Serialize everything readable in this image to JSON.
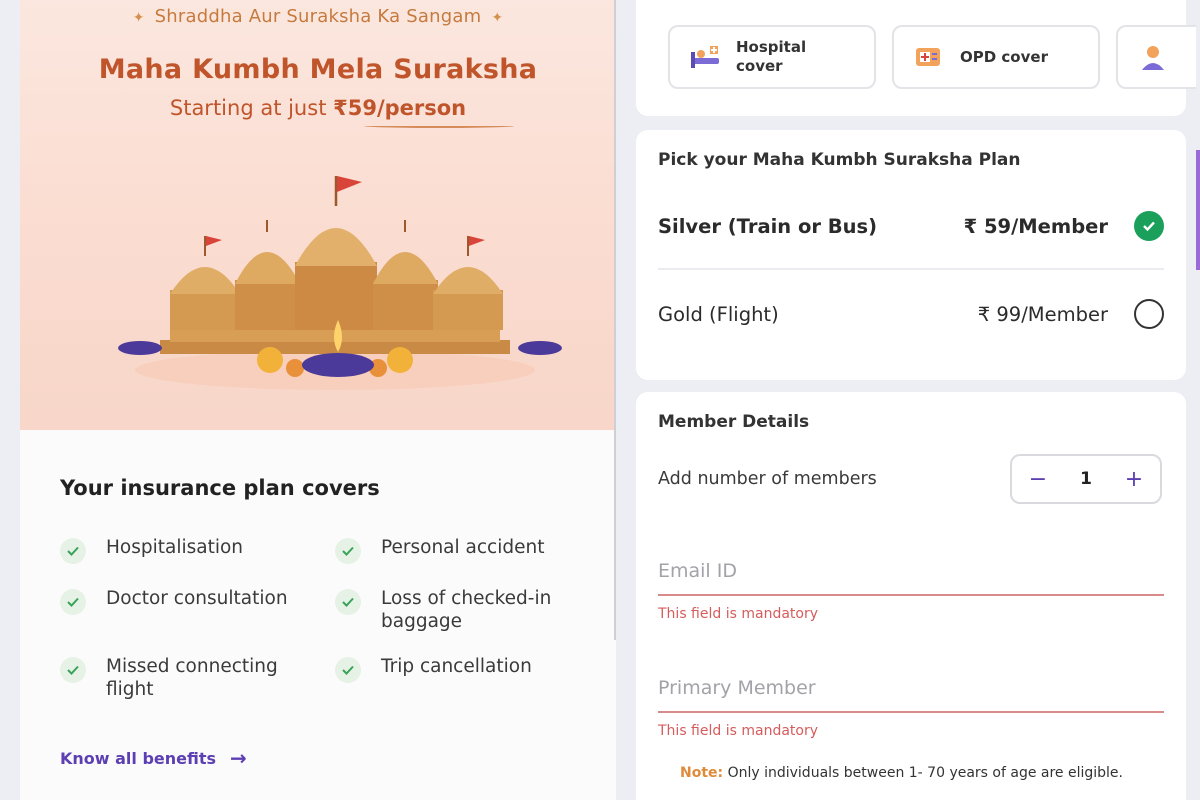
{
  "hero": {
    "tagline": "Shraddha Aur Suraksha Ka Sangam",
    "title": "Maha Kumbh Mela Suraksha",
    "subtitle_prefix": "Starting at just ",
    "subtitle_price": "₹59/person"
  },
  "covers": {
    "title": "Your insurance plan covers",
    "items": [
      {
        "label": "Hospitalisation"
      },
      {
        "label": "Personal accident"
      },
      {
        "label": "Doctor consultation"
      },
      {
        "label": "Loss of checked-in baggage"
      },
      {
        "label": "Missed connecting flight"
      },
      {
        "label": "Trip cancellation"
      }
    ],
    "link_label": "Know all benefits",
    "link_arrow": "→"
  },
  "cover_tabs": [
    {
      "label": "Hospital cover",
      "icon": "hospital-bed-icon"
    },
    {
      "label": "OPD cover",
      "icon": "opd-icon"
    },
    {
      "label": "",
      "icon": "doctor-icon"
    }
  ],
  "plan": {
    "heading": "Pick your Maha Kumbh Suraksha Plan",
    "options": [
      {
        "name": "Silver (Train or Bus)",
        "price": "₹ 59/Member",
        "selected": true
      },
      {
        "name": "Gold (Flight)",
        "price": "₹ 99/Member",
        "selected": false
      }
    ]
  },
  "members": {
    "heading": "Member Details",
    "count_label": "Add number of members",
    "count": "1",
    "minus": "−",
    "plus": "+",
    "email_placeholder": "Email ID",
    "email_value": "",
    "email_error": "This field is mandatory",
    "primary_placeholder": "Primary Member",
    "primary_value": "",
    "primary_error": "This field is mandatory",
    "note_key": "Note:",
    "note_text": " Only individuals between 1- 70 years of age are eligible."
  },
  "colors": {
    "accent": "#5b3fb3",
    "brand_orange": "#c0542a",
    "success": "#1aa05a",
    "error": "#d65c5c"
  }
}
